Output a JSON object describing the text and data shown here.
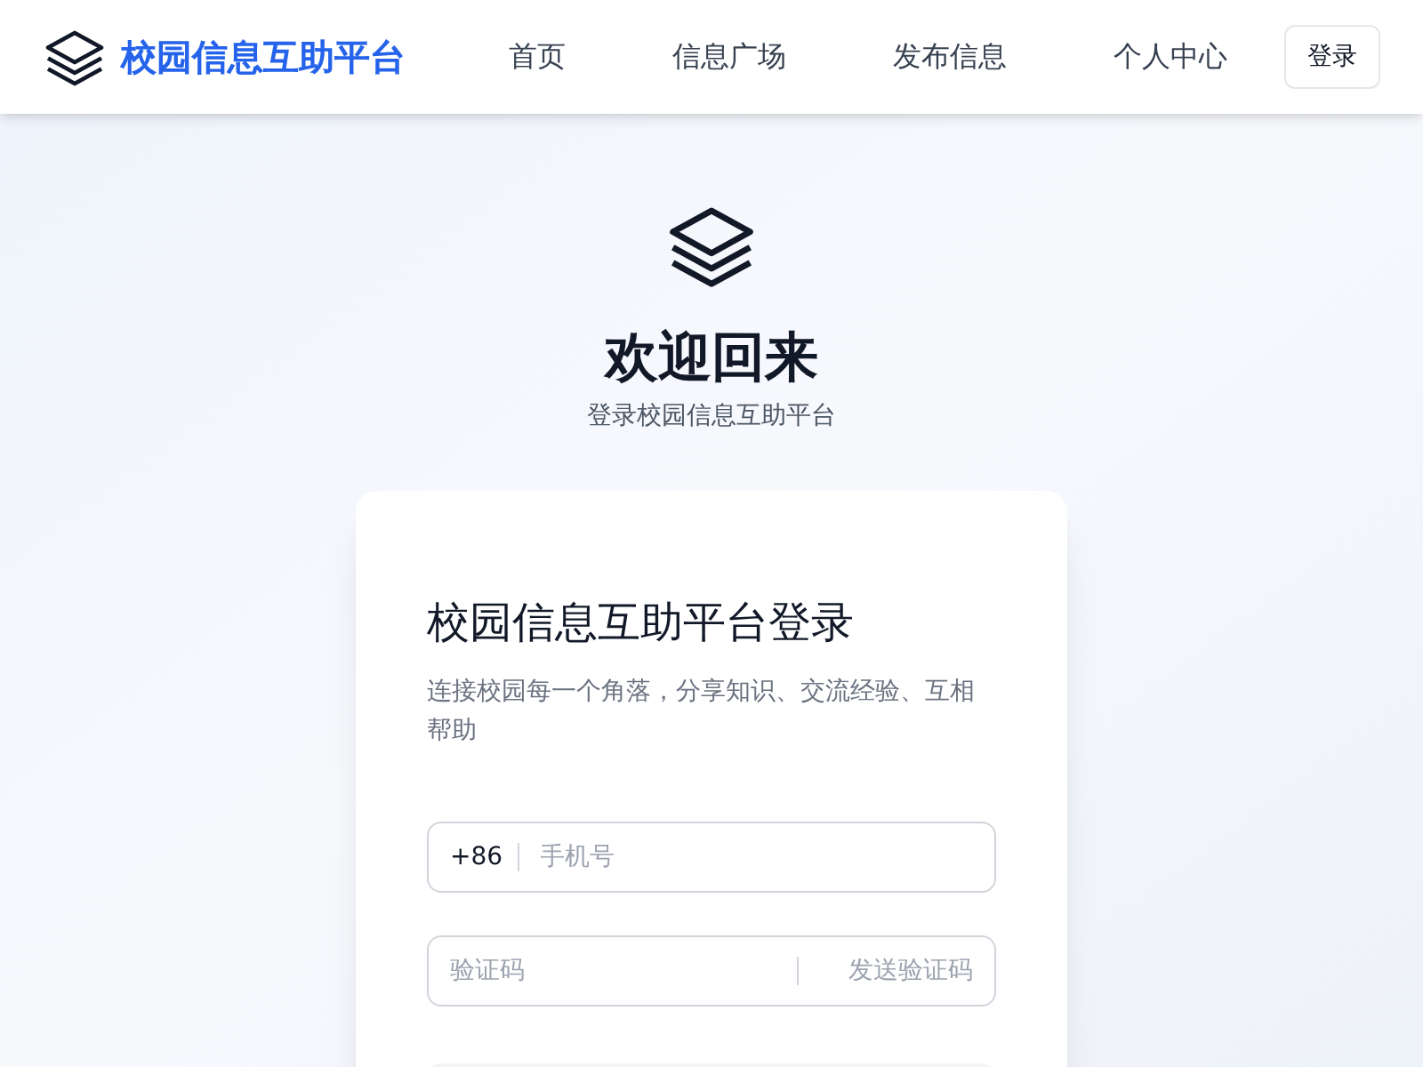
{
  "header": {
    "brand": "校园信息互助平台",
    "nav": [
      {
        "label": "首页"
      },
      {
        "label": "信息广场"
      },
      {
        "label": "发布信息"
      },
      {
        "label": "个人中心"
      }
    ],
    "login_button": "登录"
  },
  "hero": {
    "title": "欢迎回来",
    "subtitle": "登录校园信息互助平台"
  },
  "card": {
    "title": "校园信息互助平台登录",
    "description": "连接校园每一个角落，分享知识、交流经验、互相帮助",
    "phone": {
      "prefix": "+86",
      "placeholder": "手机号"
    },
    "code": {
      "placeholder": "验证码",
      "send_button": "发送验证码"
    }
  }
}
